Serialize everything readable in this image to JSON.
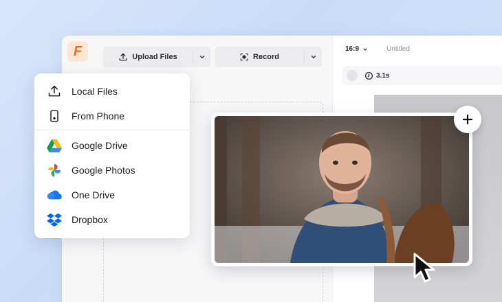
{
  "toolbar": {
    "upload_label": "Upload Files",
    "record_label": "Record"
  },
  "editor": {
    "aspect_ratio": "16:9",
    "project_title": "Untitled",
    "duration": "3.1s"
  },
  "upload_menu": {
    "items": [
      {
        "label": "Local Files",
        "icon": "upload-icon"
      },
      {
        "label": "From Phone",
        "icon": "phone-icon"
      },
      {
        "label": "Google Drive",
        "icon": "google-drive-icon"
      },
      {
        "label": "Google Photos",
        "icon": "google-photos-icon"
      },
      {
        "label": "One Drive",
        "icon": "onedrive-icon"
      },
      {
        "label": "Dropbox",
        "icon": "dropbox-icon"
      }
    ]
  },
  "colors": {
    "brand": "#f26b1d",
    "background": "#d8e6fb"
  }
}
